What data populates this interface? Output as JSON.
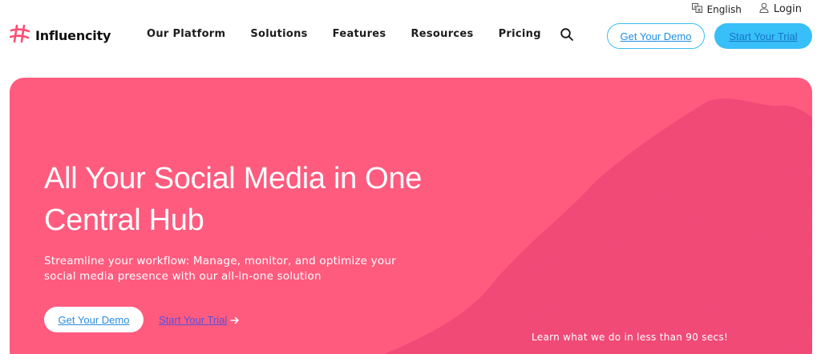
{
  "utility": {
    "language_label": "English",
    "login_label": "Login"
  },
  "brand": {
    "name": "Influencity",
    "logo_icon": "hashtag-icon",
    "accent_color": "#ff5b7f"
  },
  "nav": {
    "items": [
      {
        "label": "Our Platform"
      },
      {
        "label": "Solutions"
      },
      {
        "label": "Features"
      },
      {
        "label": "Resources"
      },
      {
        "label": "Pricing"
      }
    ]
  },
  "header_actions": {
    "search_icon": "search-icon",
    "demo_label": "Get Your Demo",
    "trial_label": "Start Your Trial",
    "trial_color": "#38bff7"
  },
  "hero": {
    "title": "All Your Social Media in One Central Hub",
    "subtitle": "Streamline your workflow: Manage, monitor, and optimize your social media presence with our all-in-one solution",
    "demo_label": "Get Your Demo",
    "trial_label": "Start Your Trial",
    "video_caption": "Learn what we do in less than 90 secs!",
    "background_color": "#ff5b7f"
  }
}
